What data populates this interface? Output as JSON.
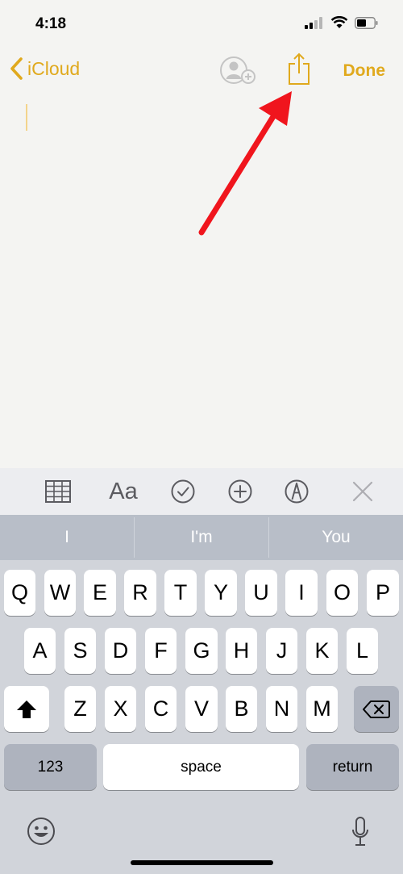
{
  "status": {
    "time": "4:18"
  },
  "nav": {
    "back_label": "iCloud",
    "done_label": "Done"
  },
  "note": {
    "text": ""
  },
  "format_bar": {
    "aa_label": "Aa"
  },
  "predictions": [
    "I",
    "I'm",
    "You"
  ],
  "keyboard": {
    "row1": [
      "Q",
      "W",
      "E",
      "R",
      "T",
      "Y",
      "U",
      "I",
      "O",
      "P"
    ],
    "row2": [
      "A",
      "S",
      "D",
      "F",
      "G",
      "H",
      "J",
      "K",
      "L"
    ],
    "row3": [
      "Z",
      "X",
      "C",
      "V",
      "B",
      "N",
      "M"
    ],
    "numbers_label": "123",
    "space_label": "space",
    "return_label": "return"
  },
  "colors": {
    "accent": "#e0a91d",
    "arrow": "#f0151d"
  }
}
